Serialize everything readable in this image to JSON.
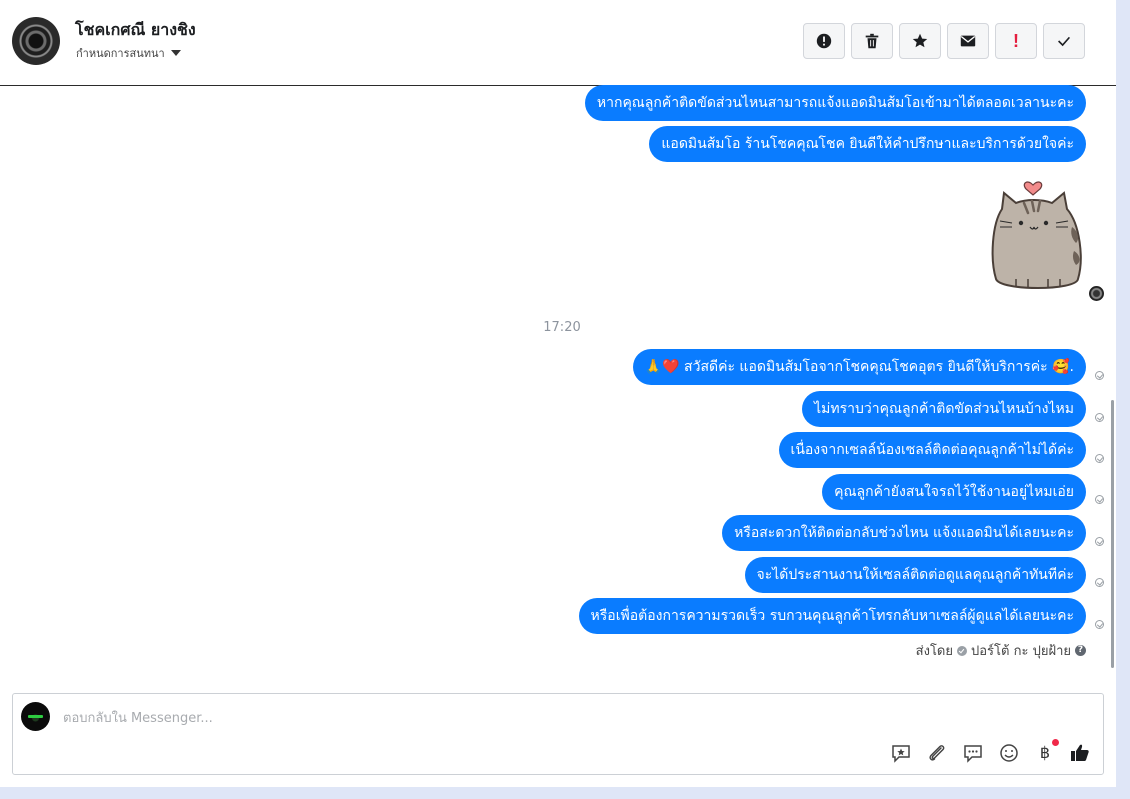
{
  "header": {
    "contact_name": "โชคเกศณี ยางชิง",
    "conversation_settings": "กำหนดการสนทนา",
    "toolbar": [
      "info-icon",
      "trash-icon",
      "star-icon",
      "envelope-icon",
      "important-icon",
      "check-icon"
    ],
    "important_glyph": "!"
  },
  "messages": {
    "sent_top": [
      "หากคุณลูกค้าติดขัดส่วนไหนสามารถแจ้งแอดมินส้มโอเข้ามาได้ตลอดเวลานะคะ",
      "แอดมินส้มโอ ร้านโชคคุณโชค ยินดีให้คำปรึกษาและบริการด้วยใจค่ะ"
    ],
    "sticker": "pusheen-cat-heart-sticker",
    "timestamp": "17:20",
    "sent_bottom": [
      "🙏❤️ สวัสดีค่ะ แอดมินส้มโอจากโชคคุณโชคอุตร ยินดีให้บริการค่ะ 🥰.",
      "ไม่ทราบว่าคุณลูกค้าติดขัดส่วนไหนบ้างไหม",
      "เนื่องจากเซลล์น้องเซลล์ติดต่อคุณลูกค้าไม่ได้ค่ะ",
      "คุณลูกค้ายังสนใจรถไว้ใช้งานอยู่ไหมเอ่ย",
      "หรือสะดวกให้ติดต่อกลับช่วงไหน แจ้งแอดมินได้เลยนะคะ",
      "จะได้ประสานงานให้เซลล์ติดต่อดูแลคุณลูกค้าทันทีค่ะ",
      "หรือเพื่อต้องการความรวดเร็ว รบกวนคุณลูกค้าโทรกลับหาเซลล์ผู้ดูแลได้เลยนะคะ"
    ],
    "sent_by_label": "ส่งโดย",
    "sent_by_name": "ปอร์โต้ กะ ปุยฝ้าย",
    "help_glyph": "?"
  },
  "composer": {
    "placeholder": "ตอบกลับใน Messenger...",
    "icons": [
      "saved-reply-icon",
      "attachment-icon",
      "chat-bubble-icon",
      "emoji-icon",
      "baht-payment-icon",
      "thumbs-up-icon"
    ],
    "baht_glyph": "฿"
  },
  "colors": {
    "bubble": "#0a7cff",
    "important": "#e41e3f",
    "notification_dot": "#f02849"
  }
}
